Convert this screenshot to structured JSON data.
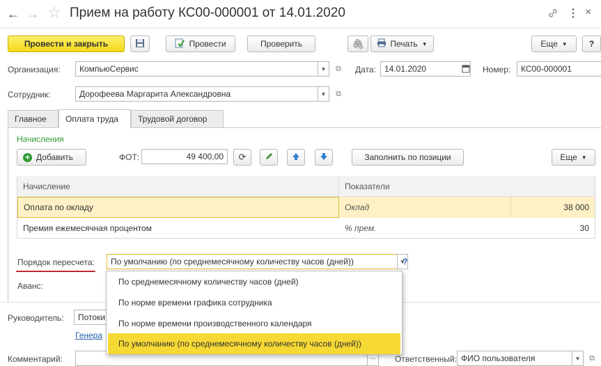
{
  "window": {
    "title": "Прием на работу КС00-000001 от 14.01.2020"
  },
  "toolbar": {
    "post_close": "Провести и закрыть",
    "post": "Провести",
    "check": "Проверить",
    "print": "Печать",
    "more": "Еще",
    "help": "?"
  },
  "header": {
    "org_label": "Организация:",
    "org_value": "КомпьюСервис",
    "date_label": "Дата:",
    "date_value": "14.01.2020",
    "number_label": "Номер:",
    "number_value": "КС00-000001",
    "employee_label": "Сотрудник:",
    "employee_value": "Дорофеева Маргарита Александровна"
  },
  "tabs": [
    {
      "label": "Главное"
    },
    {
      "label": "Оплата труда"
    },
    {
      "label": "Трудовой договор"
    }
  ],
  "accruals": {
    "section_title": "Начисления",
    "add_label": "Добавить",
    "fot_label": "ФОТ:",
    "fot_value": "49 400,00",
    "fill_label": "Заполнить по позиции",
    "more_label": "Еще",
    "columns": [
      "Начисление",
      "Показатели"
    ],
    "rows": [
      {
        "name": "Оплата по окладу",
        "indicator": "Оклад",
        "value": "38 000"
      },
      {
        "name": "Премия ежемесячная процентом",
        "indicator": "% прем.",
        "value": "30"
      }
    ]
  },
  "recalc": {
    "label": "Порядок пересчета:",
    "value": "По умолчанию (по среднемесячному количеству часов (дней))",
    "help": "?",
    "options": [
      "По среднемесячному количеству часов (дней)",
      "По норме времени графика сотрудника",
      "По норме времени производственного календаря",
      "По умолчанию (по среднемесячному количеству часов (дней))"
    ]
  },
  "advance": {
    "label": "Аванс:"
  },
  "footer": {
    "manager_label": "Руководитель:",
    "manager_value": "Потоки",
    "generate_link": "Генера",
    "comment_label": "Комментарий:",
    "comment_dots": "...",
    "responsible_label": "Ответственный:",
    "responsible_value": "ФИО пользователя"
  },
  "colors": {
    "accent_yellow": "#f5dc2a",
    "highlight_row": "#fdf1c5",
    "selected_option": "#f6d934",
    "section_green": "#2e9b33",
    "link": "#1f5fa8"
  }
}
